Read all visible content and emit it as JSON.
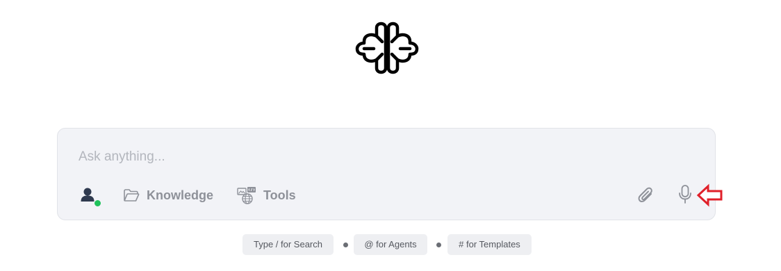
{
  "composer": {
    "placeholder": "Ask anything...",
    "value": "",
    "knowledge_label": "Knowledge",
    "tools_label": "Tools",
    "agent_status": "online"
  },
  "hints": [
    {
      "label": "Type / for Search"
    },
    {
      "label": "@ for Agents"
    },
    {
      "label": "# for Templates"
    }
  ],
  "icons": {
    "logo": "brain-logo-icon",
    "agent": "user-avatar-icon",
    "knowledge": "folder-icon",
    "tools": "tools-globe-icon",
    "attach": "paperclip-icon",
    "mic": "microphone-icon",
    "annotation": "red-arrow-left-icon"
  },
  "colors": {
    "composer_bg": "#f2f3f7",
    "status_online": "#1fc25b",
    "annotation_arrow": "#e0202a",
    "muted_text": "#8e9199"
  }
}
